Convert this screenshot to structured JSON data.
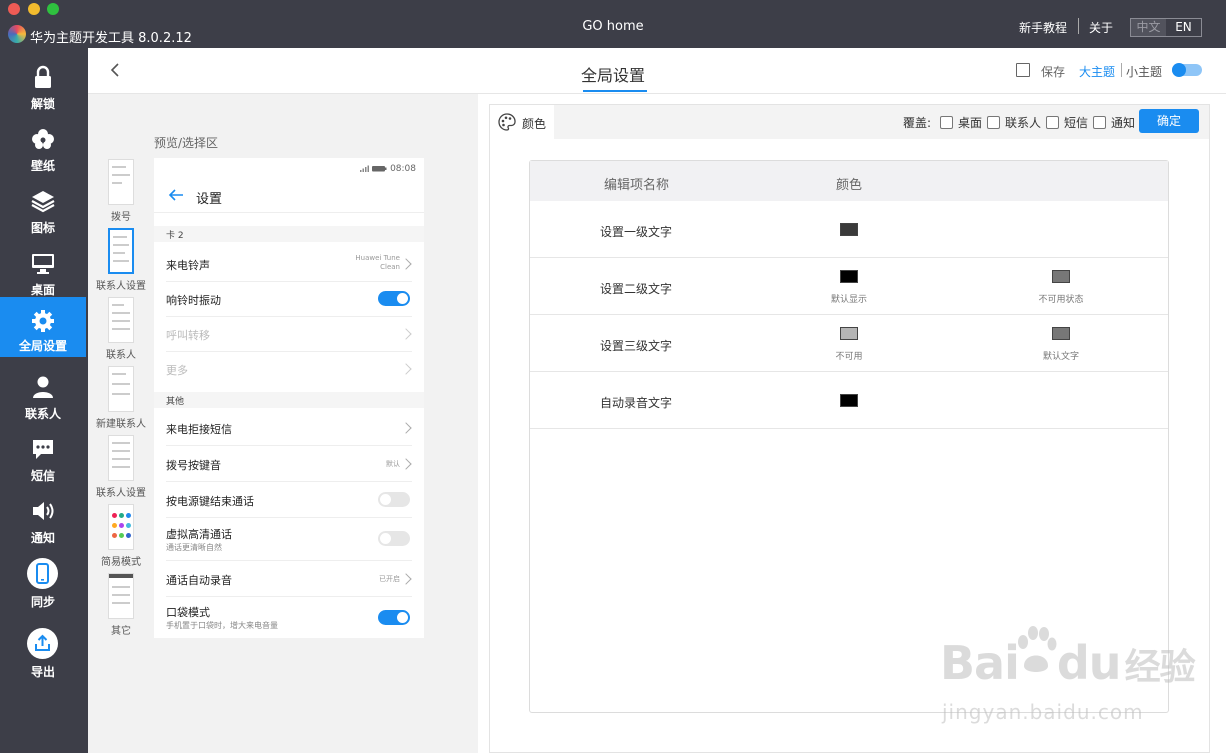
{
  "titlebar": {
    "app_name": "华为主题开发工具 8.0.2.12",
    "window_title": "GO home",
    "tutorial": "新手教程",
    "about": "关于",
    "lang_zh": "中文",
    "lang_en": "EN"
  },
  "sidebar": {
    "items": [
      {
        "label": "解锁",
        "icon": "lock-icon"
      },
      {
        "label": "壁纸",
        "icon": "flower-icon"
      },
      {
        "label": "图标",
        "icon": "layers-icon"
      },
      {
        "label": "桌面",
        "icon": "monitor-icon"
      },
      {
        "label": "全局设置",
        "icon": "gear-icon",
        "active": true
      },
      {
        "label": "联系人",
        "icon": "person-icon"
      },
      {
        "label": "短信",
        "icon": "message-icon"
      },
      {
        "label": "通知",
        "icon": "speaker-icon"
      },
      {
        "label": "同步",
        "icon": "phone-icon"
      },
      {
        "label": "导出",
        "icon": "export-icon"
      }
    ]
  },
  "header": {
    "title": "全局设置",
    "save": "保存",
    "theme_big": "大主题",
    "theme_small": "小主题"
  },
  "preview": {
    "heading": "预览/选择区",
    "thumbs": [
      {
        "label": "拨号"
      },
      {
        "label": "联系人设置"
      },
      {
        "label": "联系人"
      },
      {
        "label": "新建联系人"
      },
      {
        "label": "联系人设置"
      },
      {
        "label": "简易模式"
      },
      {
        "label": "其它"
      }
    ]
  },
  "phone": {
    "time": "08:08",
    "title": "设置",
    "section1": "卡 2",
    "section2": "其他",
    "rows": [
      {
        "title": "来电铃声",
        "value1": "Huawei Tune",
        "value2": "Clean"
      },
      {
        "title": "响铃时振动"
      },
      {
        "title": "呼叫转移"
      },
      {
        "title": "更多"
      },
      {
        "title": "来电拒接短信"
      },
      {
        "title": "拨号按键音",
        "value": "默认"
      },
      {
        "title": "按电源键结束通话"
      },
      {
        "title": "虚拟高清通话",
        "sub": "通话更清晰自然"
      },
      {
        "title": "通话自动录音",
        "value": "已开启"
      },
      {
        "title": "口袋模式",
        "sub": "手机置于口袋时，增大来电音量"
      }
    ]
  },
  "editor": {
    "tab": "颜色",
    "cover_label": "覆盖:",
    "cover_options": [
      "桌面",
      "联系人",
      "短信",
      "通知"
    ],
    "confirm": "确定",
    "table": {
      "col_name": "编辑项名称",
      "col_color": "颜色",
      "rows": [
        {
          "name": "设置一级文字",
          "swatches": [
            {
              "color": "#3a3a3a",
              "label": ""
            }
          ]
        },
        {
          "name": "设置二级文字",
          "swatches": [
            {
              "color": "#000000",
              "label": "默认显示"
            },
            {
              "color": "#777777",
              "label": "不可用状态"
            }
          ]
        },
        {
          "name": "设置三级文字",
          "swatches": [
            {
              "color": "#b5b5b5",
              "label": "不可用"
            },
            {
              "color": "#777777",
              "label": "默认文字"
            }
          ]
        },
        {
          "name": "自动录音文字",
          "swatches": [
            {
              "color": "#000000",
              "label": ""
            }
          ]
        }
      ]
    }
  },
  "watermark": {
    "brand": "Bai",
    "brand2": "du",
    "suffix": "经验",
    "url": "jingyan.baidu.com"
  }
}
